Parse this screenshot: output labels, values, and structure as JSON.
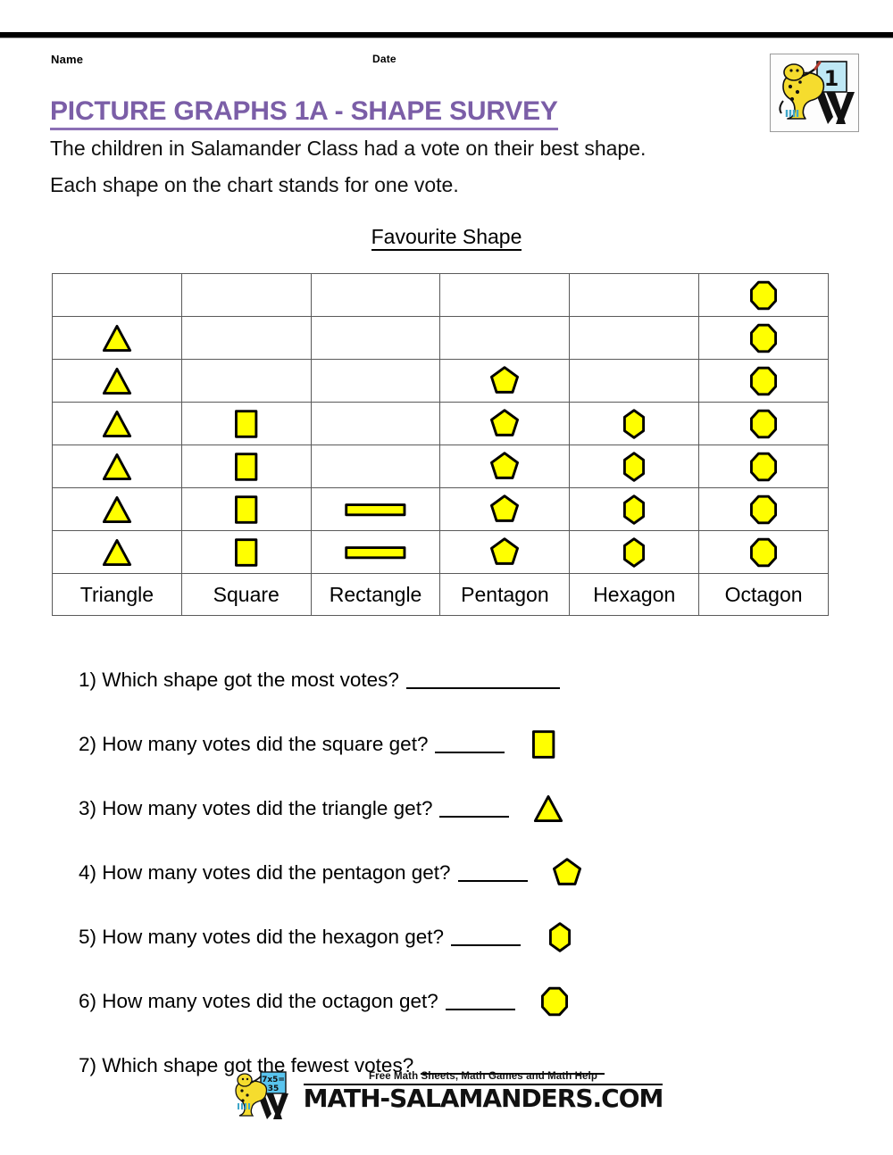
{
  "header": {
    "name_label": "Name",
    "date_label": "Date",
    "badge": {
      "icon": "salamander-chalkboard-icon",
      "level": "1"
    }
  },
  "title": "PICTURE GRAPHS 1A - SHAPE SURVEY",
  "intro": {
    "line1": "The children in Salamander Class had a vote on their best shape.",
    "line2": "Each shape on the chart stands for one vote."
  },
  "chart_data": {
    "type": "bar",
    "title": "Favourite Shape",
    "xlabel": "",
    "ylabel": "",
    "categories": [
      "Triangle",
      "Square",
      "Rectangle",
      "Pentagon",
      "Hexagon",
      "Octagon"
    ],
    "values": [
      6,
      4,
      2,
      5,
      4,
      7
    ],
    "icons": [
      "triangle",
      "square",
      "rectangle",
      "pentagon",
      "hexagon",
      "octagon"
    ],
    "rows": 7,
    "unit_note": "Each shape on the chart stands for one vote.",
    "grid": true,
    "legend": "none",
    "ylim": [
      0,
      7
    ],
    "shape_fill": "#FFFF00",
    "shape_stroke": "#000000"
  },
  "questions": [
    {
      "num": "1)",
      "text": "Which shape got the most votes?",
      "blank": "long",
      "icon": ""
    },
    {
      "num": "2)",
      "text": "How many votes did the square get?",
      "blank": "short",
      "icon": "square"
    },
    {
      "num": "3)",
      "text": "How many votes did the triangle get?",
      "blank": "short",
      "icon": "triangle"
    },
    {
      "num": "4)",
      "text": "How many votes did the pentagon get?",
      "blank": "short",
      "icon": "pentagon"
    },
    {
      "num": "5)",
      "text": "How many votes did the hexagon get?",
      "blank": "short",
      "icon": "hexagon"
    },
    {
      "num": "6)",
      "text": "How many votes did the octagon get?",
      "blank": "short",
      "icon": "octagon"
    },
    {
      "num": "7)",
      "text": "Which shape got the fewest votes?",
      "blank": "xlong",
      "icon": ""
    }
  ],
  "footer": {
    "tagline": "Free Math Sheets, Math Games and Math Help",
    "url": "MATH-SALAMANDERS.COM",
    "logo_icon": "salamander-chalkboard-icon",
    "logo_board_text": "7x5=\n35"
  },
  "colors": {
    "title": "#7B5EA7",
    "shape_fill": "#FFFF00",
    "shape_stroke": "#000000",
    "rule": "#000000"
  }
}
